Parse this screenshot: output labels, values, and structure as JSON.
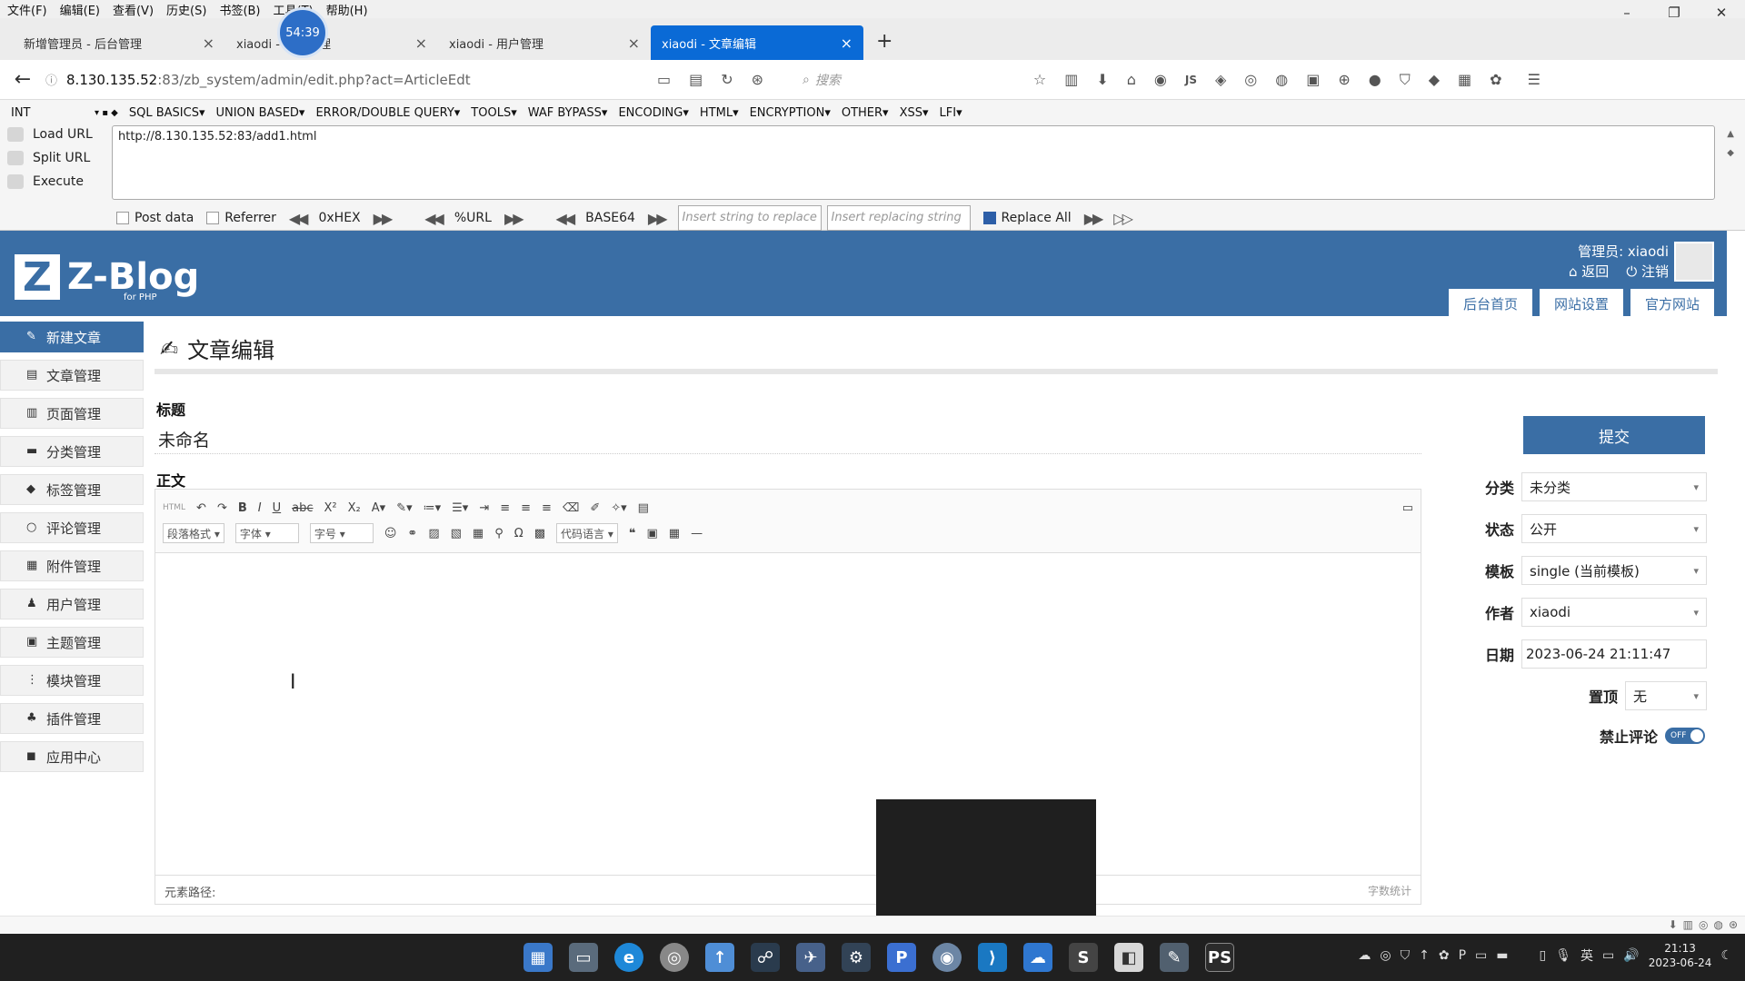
{
  "menubar": [
    "文件(F)",
    "编辑(E)",
    "查看(V)",
    "历史(S)",
    "书签(B)",
    "工具(T)",
    "帮助(H)"
  ],
  "timer": "54:39",
  "tabs": [
    {
      "label": "新增管理员 - 后台管理",
      "active": false
    },
    {
      "label": "xiaodi - 用户管理",
      "active": false
    },
    {
      "label": "xiaodi - 用户管理",
      "active": false
    },
    {
      "label": "xiaodi - 文章编辑",
      "active": true
    }
  ],
  "address": {
    "host": "8.130.135.52",
    "path": ":83/zb_system/admin/edit.php?act=ArticleEdt",
    "search_placeholder": "搜索"
  },
  "hackbar": {
    "mode": "INT",
    "menu": [
      "SQL BASICS▾",
      "UNION BASED▾",
      "ERROR/DOUBLE QUERY▾",
      "TOOLS▾",
      "WAF BYPASS▾",
      "ENCODING▾",
      "HTML▾",
      "ENCRYPTION▾",
      "OTHER▾",
      "XSS▾",
      "LFI▾"
    ],
    "load_url": "Load URL",
    "split_url": "Split URL",
    "execute": "Execute",
    "url_value": "http://8.130.135.52:83/add1.html",
    "post_data": "Post data",
    "referrer": "Referrer",
    "hex": "0xHEX",
    "urlenc": "%URL",
    "base64": "BASE64",
    "insert_ph": "Insert string to replace",
    "replacing_ph": "Insert replacing string",
    "replace_all": "Replace All"
  },
  "zblog": {
    "brand": "Z-Blog",
    "brand_sub": "for PHP",
    "admin": "管理员: xiaodi",
    "back": "返回",
    "logout": "注销",
    "toplinks": [
      "后台首页",
      "网站设置",
      "官方网站"
    ]
  },
  "sidebar": [
    {
      "label": "新建文章",
      "active": true
    },
    {
      "label": "文章管理",
      "active": false
    },
    {
      "label": "页面管理",
      "active": false
    },
    {
      "label": "分类管理",
      "active": false
    },
    {
      "label": "标签管理",
      "active": false
    },
    {
      "label": "评论管理",
      "active": false
    },
    {
      "label": "附件管理",
      "active": false
    },
    {
      "label": "用户管理",
      "active": false
    },
    {
      "label": "主题管理",
      "active": false
    },
    {
      "label": "模块管理",
      "active": false
    },
    {
      "label": "插件管理",
      "active": false
    },
    {
      "label": "应用中心",
      "active": false
    }
  ],
  "editor": {
    "page_title": "文章编辑",
    "title_label": "标题",
    "title_value": "未命名",
    "body_label": "正文",
    "para_format": "段落格式",
    "font": "字体",
    "font_size": "字号",
    "code_lang": "代码语言",
    "path_label": "元素路径:",
    "word_count": "字数统计"
  },
  "panel": {
    "submit": "提交",
    "category_label": "分类",
    "category": "未分类",
    "status_label": "状态",
    "status": "公开",
    "template_label": "模板",
    "template": "single (当前模板)",
    "author_label": "作者",
    "author": "xiaodi",
    "date_label": "日期",
    "date": "2023-06-24 21:11:47",
    "top_label": "置顶",
    "top": "无",
    "nocomment_label": "禁止评论",
    "nocomment": "OFF"
  },
  "taskbar": {
    "ime": "英",
    "time": "21:13",
    "date": "2023-06-24"
  }
}
